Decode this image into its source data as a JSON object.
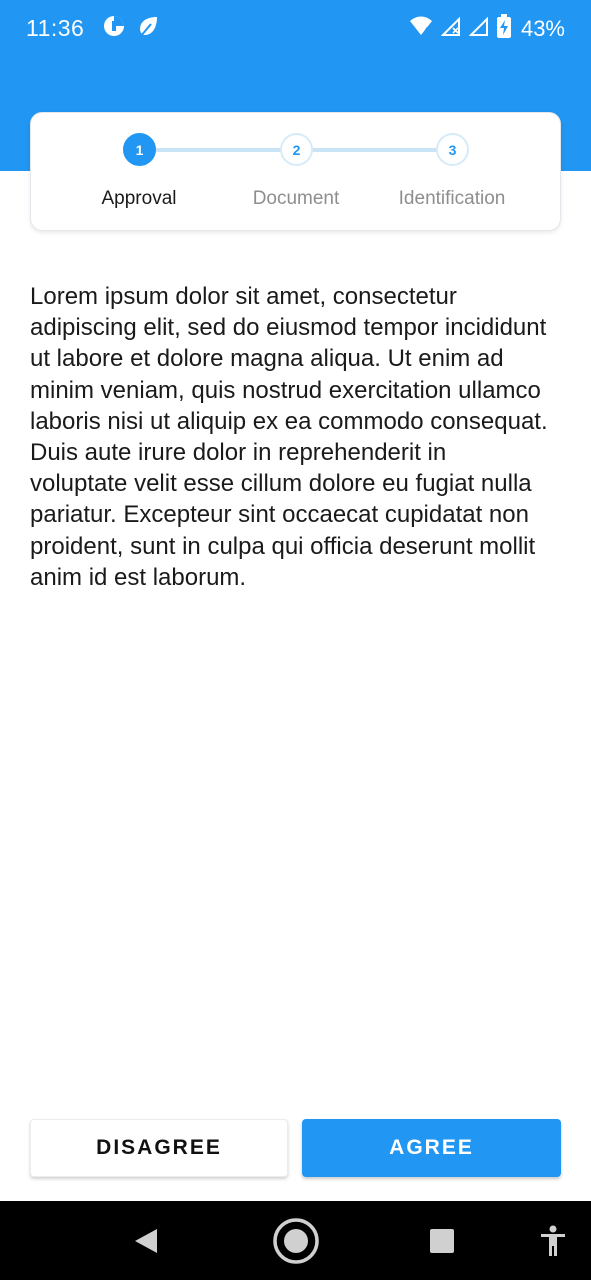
{
  "status_bar": {
    "time": "11:36",
    "left_icons": [
      "data-saver-icon",
      "leaf-icon"
    ],
    "right_icons": [
      "wifi-icon",
      "signal-icon",
      "signal-icon",
      "battery-charging-icon"
    ],
    "battery_text": "43%"
  },
  "colors": {
    "primary": "#2196f3",
    "step_track": "#c9e4f6",
    "text": "#1a1a1a",
    "muted_text": "#8e8e8e"
  },
  "stepper": {
    "steps": [
      {
        "number": "1",
        "label": "Approval",
        "active": true
      },
      {
        "number": "2",
        "label": "Document",
        "active": false
      },
      {
        "number": "3",
        "label": "Identification",
        "active": false
      }
    ]
  },
  "content": {
    "body": "Lorem ipsum dolor sit amet, consectetur adipiscing elit, sed do eiusmod tempor incididunt ut labore et dolore magna aliqua. Ut enim ad minim veniam, quis nostrud exercitation ullamco laboris nisi ut aliquip ex ea commodo consequat. Duis aute irure dolor in reprehenderit in voluptate velit esse cillum dolore eu fugiat nulla pariatur. Excepteur sint occaecat cupidatat non proident, sunt in culpa qui officia deserunt mollit anim id est laborum."
  },
  "actions": {
    "disagree_label": "DISAGREE",
    "agree_label": "AGREE"
  },
  "nav_bar": {
    "items": [
      "back-icon",
      "home-icon",
      "recents-icon",
      "accessibility-icon"
    ]
  }
}
